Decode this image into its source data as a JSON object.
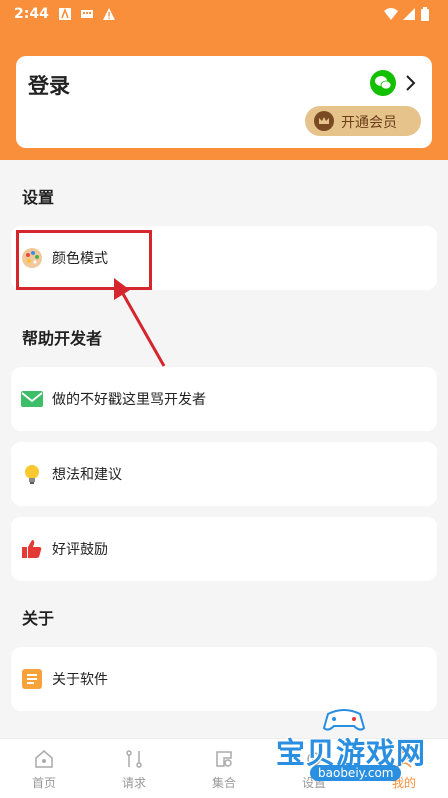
{
  "status_bar": {
    "time": "2:44"
  },
  "login_card": {
    "title": "登录",
    "vip_label": "开通会员"
  },
  "sections": {
    "settings": {
      "title": "设置",
      "items": [
        {
          "label": "颜色模式"
        }
      ]
    },
    "help": {
      "title": "帮助开发者",
      "items": [
        {
          "label": "做的不好戳这里骂开发者"
        },
        {
          "label": "想法和建议"
        },
        {
          "label": "好评鼓励"
        }
      ]
    },
    "about": {
      "title": "关于",
      "items": [
        {
          "label": "关于软件"
        }
      ]
    }
  },
  "bottom_nav": {
    "items": [
      {
        "label": "首页",
        "icon": "home-icon"
      },
      {
        "label": "请求",
        "icon": "request-icon"
      },
      {
        "label": "集合",
        "icon": "collection-icon"
      },
      {
        "label": "设置",
        "icon": "settings-icon"
      },
      {
        "label": "我的",
        "icon": "profile-icon"
      }
    ],
    "active_index": 4
  },
  "watermark": {
    "text": "宝贝游戏网",
    "url": "baobeiy.com"
  },
  "colors": {
    "accent": "#f98f3a",
    "highlight": "#d4262c",
    "wechat": "#13c000",
    "vip_bg": "#e7c38c"
  }
}
